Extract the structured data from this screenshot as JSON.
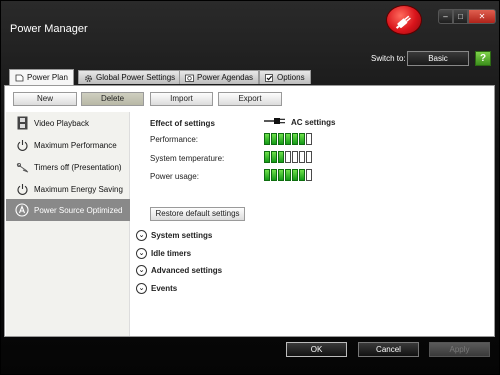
{
  "window": {
    "title": "Power Manager"
  },
  "titlebar": {
    "minimize": "–",
    "maximize": "□",
    "close": "✕"
  },
  "switch": {
    "label": "Switch to:",
    "button": "Basic",
    "help": "?"
  },
  "tabs": [
    {
      "label": "Power Plan",
      "icon": "document-icon",
      "active": true
    },
    {
      "label": "Global Power Settings",
      "icon": "gear-icon"
    },
    {
      "label": "Power Agendas",
      "icon": "agenda-icon"
    },
    {
      "label": "Options",
      "icon": "checkbox-icon"
    }
  ],
  "toolbar": {
    "new": "New",
    "delete": "Delete",
    "import": "Import",
    "export": "Export"
  },
  "plans": [
    {
      "label": "Video Playback",
      "icon": "film-icon"
    },
    {
      "label": "Maximum Performance",
      "icon": "power-icon"
    },
    {
      "label": "Timers off (Presentation)",
      "icon": "presentation-icon"
    },
    {
      "label": "Maximum Energy Saving",
      "icon": "power-icon"
    },
    {
      "label": "Power Source Optimized",
      "icon": "a-circle-icon",
      "selected": true
    }
  ],
  "effect": {
    "title": "Effect of settings",
    "source_label": "AC settings",
    "source_icon": "plug-icon",
    "metrics": [
      {
        "label": "Performance:",
        "level": 6,
        "max": 7
      },
      {
        "label": "System temperature:",
        "level": 3,
        "max": 7
      },
      {
        "label": "Power usage:",
        "level": 6,
        "max": 7
      }
    ]
  },
  "restore_button": "Restore default settings",
  "sections": [
    "System settings",
    "Idle timers",
    "Advanced settings",
    "Events"
  ],
  "footer": {
    "ok": "OK",
    "cancel": "Cancel",
    "apply": "Apply"
  },
  "colors": {
    "accent_red": "#d9141b",
    "meter_green": "#2fc22a",
    "selected_plan": "#898989"
  }
}
